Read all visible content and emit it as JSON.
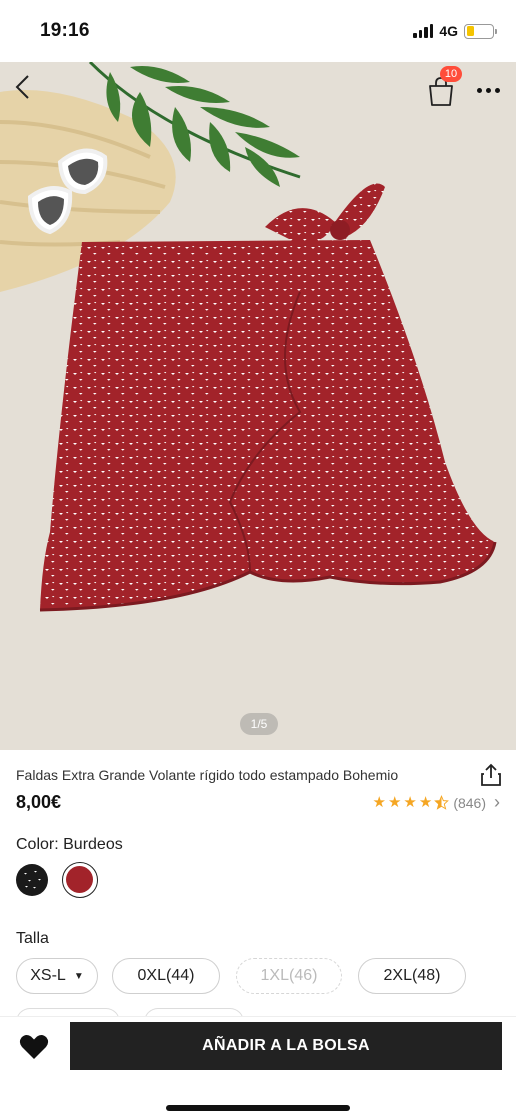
{
  "status": {
    "time": "19:16",
    "network": "4G"
  },
  "header": {
    "bag_count": "10"
  },
  "gallery": {
    "page_indicator": "1/5"
  },
  "product": {
    "title": "Faldas Extra Grande Volante rígido todo estampado Bohemio",
    "price": "8,00€",
    "rating_count": "(846)",
    "rating_stars": 4.5,
    "color_label": "Color: Burdeos",
    "size_label": "Talla"
  },
  "sizes": [
    {
      "label": "XS-L",
      "state": "selectable-dropdown"
    },
    {
      "label": "0XL(44)",
      "state": "available"
    },
    {
      "label": "1XL(46)",
      "state": "sold-out"
    },
    {
      "label": "2XL(48)",
      "state": "available"
    }
  ],
  "colors": {
    "accent": "#222222",
    "badge": "#ff4d3a",
    "star": "#f5a623",
    "skirt": "#a2232a"
  },
  "actions": {
    "add_to_bag": "AÑADIR A LA BOLSA"
  },
  "icons": [
    "back-arrow-icon",
    "shopping-bag-icon",
    "more-dots-icon",
    "share-icon",
    "star-icon",
    "chevron-right-icon",
    "heart-icon"
  ]
}
